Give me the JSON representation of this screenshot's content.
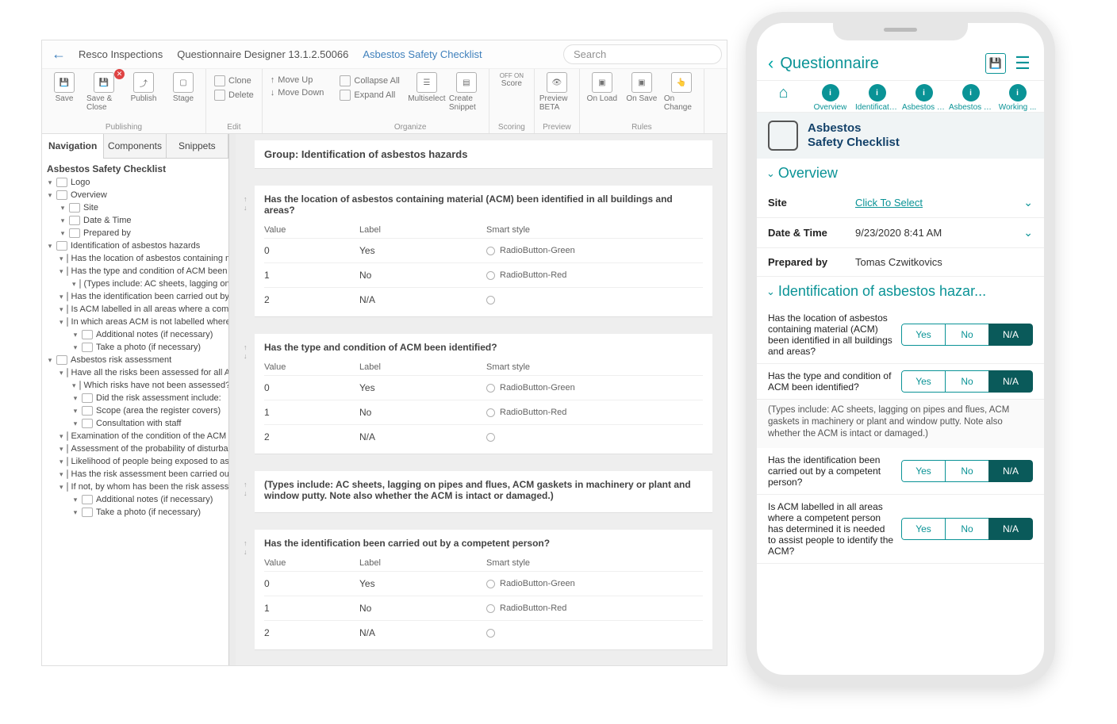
{
  "breadcrumb": {
    "app": "Resco Inspections",
    "designer": "Questionnaire Designer 13.1.2.50066",
    "entity": "Asbestos Safety Checklist"
  },
  "search": {
    "placeholder": "Search"
  },
  "ribbon": {
    "publishing": {
      "label": "Publishing",
      "save": "Save",
      "saveClose": "Save & Close",
      "publish": "Publish",
      "stage": "Stage"
    },
    "edit": {
      "label": "Edit",
      "clone": "Clone",
      "delete": "Delete",
      "moveUp": "Move Up",
      "moveDown": "Move Down"
    },
    "organize": {
      "label": "Organize",
      "collapseAll": "Collapse All",
      "expandAll": "Expand All",
      "multiselect": "Multiselect",
      "createSnippet": "Create Snippet"
    },
    "scoring": {
      "label": "Scoring",
      "score": "Score",
      "offOn": "OFF  ON"
    },
    "preview": {
      "label": "Preview",
      "preview": "Preview BETA"
    },
    "rules": {
      "label": "Rules",
      "onLoad": "On Load",
      "onSave": "On Save",
      "onChange": "On Change"
    }
  },
  "nav": {
    "tabs": [
      "Navigation",
      "Components",
      "Snippets"
    ],
    "title": "Asbestos Safety Checklist",
    "items": [
      {
        "ind": 1,
        "label": "Logo"
      },
      {
        "ind": 1,
        "label": "Overview"
      },
      {
        "ind": 2,
        "label": "Site"
      },
      {
        "ind": 2,
        "label": "Date & Time"
      },
      {
        "ind": 2,
        "label": "Prepared by"
      },
      {
        "ind": 1,
        "label": "Identification of asbestos hazards"
      },
      {
        "ind": 2,
        "label": "Has the location of asbestos containing ma"
      },
      {
        "ind": 2,
        "label": "Has the type and condition of ACM been id."
      },
      {
        "ind": 3,
        "label": "(Types include: AC sheets, lagging on"
      },
      {
        "ind": 2,
        "label": "Has the identification been carried out by a"
      },
      {
        "ind": 2,
        "label": "Is ACM labelled in all areas where a compe"
      },
      {
        "ind": 2,
        "label": "In which areas ACM is not labelled where a"
      },
      {
        "ind": 3,
        "label": "Additional notes (if necessary)"
      },
      {
        "ind": 3,
        "label": "Take a photo (if necessary)"
      },
      {
        "ind": 1,
        "label": "Asbestos risk assessment"
      },
      {
        "ind": 2,
        "label": "Have all the risks been assessed for all AC."
      },
      {
        "ind": 3,
        "label": "Which risks have not been assessed?"
      },
      {
        "ind": 3,
        "label": "Did the risk assessment include:"
      },
      {
        "ind": 3,
        "label": "Scope (area the register covers)"
      },
      {
        "ind": 3,
        "label": "Consultation with staff"
      },
      {
        "ind": 2,
        "label": "Examination of the condition of the ACM (e."
      },
      {
        "ind": 2,
        "label": "Assessment of the probability of disturbanc"
      },
      {
        "ind": 2,
        "label": "Likelihood of people being exposed to asbe"
      },
      {
        "ind": 2,
        "label": "Has the risk assessment been carried out b"
      },
      {
        "ind": 2,
        "label": "If not, by whom has been the risk assessm."
      },
      {
        "ind": 3,
        "label": "Additional notes (if necessary)"
      },
      {
        "ind": 3,
        "label": "Take a photo (if necessary)"
      }
    ]
  },
  "canvas": {
    "groupTitle": "Group: Identification of asbestos hazards",
    "hdrValue": "Value",
    "hdrLabel": "Label",
    "hdrStyle": "Smart style",
    "questions": [
      {
        "title": "Has the location of asbestos containing material (ACM) been identified in all buildings and areas?",
        "options": [
          {
            "value": "0",
            "label": "Yes",
            "style": "RadioButton-Green"
          },
          {
            "value": "1",
            "label": "No",
            "style": "RadioButton-Red"
          },
          {
            "value": "2",
            "label": "N/A",
            "style": "<Default>"
          }
        ]
      },
      {
        "title": "Has the type and condition of ACM been identified?",
        "options": [
          {
            "value": "0",
            "label": "Yes",
            "style": "RadioButton-Green"
          },
          {
            "value": "1",
            "label": "No",
            "style": "RadioButton-Red"
          },
          {
            "value": "2",
            "label": "N/A",
            "style": "<Default>"
          }
        ]
      },
      {
        "title": "(Types include: AC sheets, lagging on pipes and flues, ACM gaskets in machinery or plant and window putty. Note also whether the ACM is intact or damaged.)",
        "options": []
      },
      {
        "title": "Has the identification been carried out by a competent person?",
        "options": [
          {
            "value": "0",
            "label": "Yes",
            "style": "RadioButton-Green"
          },
          {
            "value": "1",
            "label": "No",
            "style": "RadioButton-Red"
          },
          {
            "value": "2",
            "label": "N/A",
            "style": "<Default>"
          }
        ]
      }
    ]
  },
  "phone": {
    "header": "Questionnaire",
    "tabs": [
      "",
      "Overview",
      "Identification...",
      "Asbestos ris...",
      "Asbestos re...",
      "Working ..."
    ],
    "hero1": "Asbestos",
    "hero2": "Safety Checklist",
    "section_overview": "Overview",
    "fields": {
      "siteLabel": "Site",
      "siteValue": "Click To Select",
      "dateLabel": "Date & Time",
      "dateValue": "9/23/2020 8:41 AM",
      "prepLabel": "Prepared by",
      "prepValue": "Tomas Czwitkovics"
    },
    "section_ident": "Identification of asbestos hazar...",
    "questions": [
      {
        "text": "Has the location of asbestos containing material (ACM) been identified in all buildings and areas?",
        "sel": 2
      },
      {
        "text": "Has the type and condition of ACM been identified?",
        "sel": 2
      },
      {
        "text": "Has the identification been carried out by a competent person?",
        "sel": 2
      },
      {
        "text": "Is ACM labelled in all areas where a competent person has determined it is needed to assist people to identify the ACM?",
        "sel": 2
      }
    ],
    "note": "(Types include: AC sheets, lagging on pipes and flues, ACM gaskets in machinery or plant and window putty. Note also whether the ACM is intact or damaged.)",
    "segLabels": [
      "Yes",
      "No",
      "N/A"
    ]
  }
}
